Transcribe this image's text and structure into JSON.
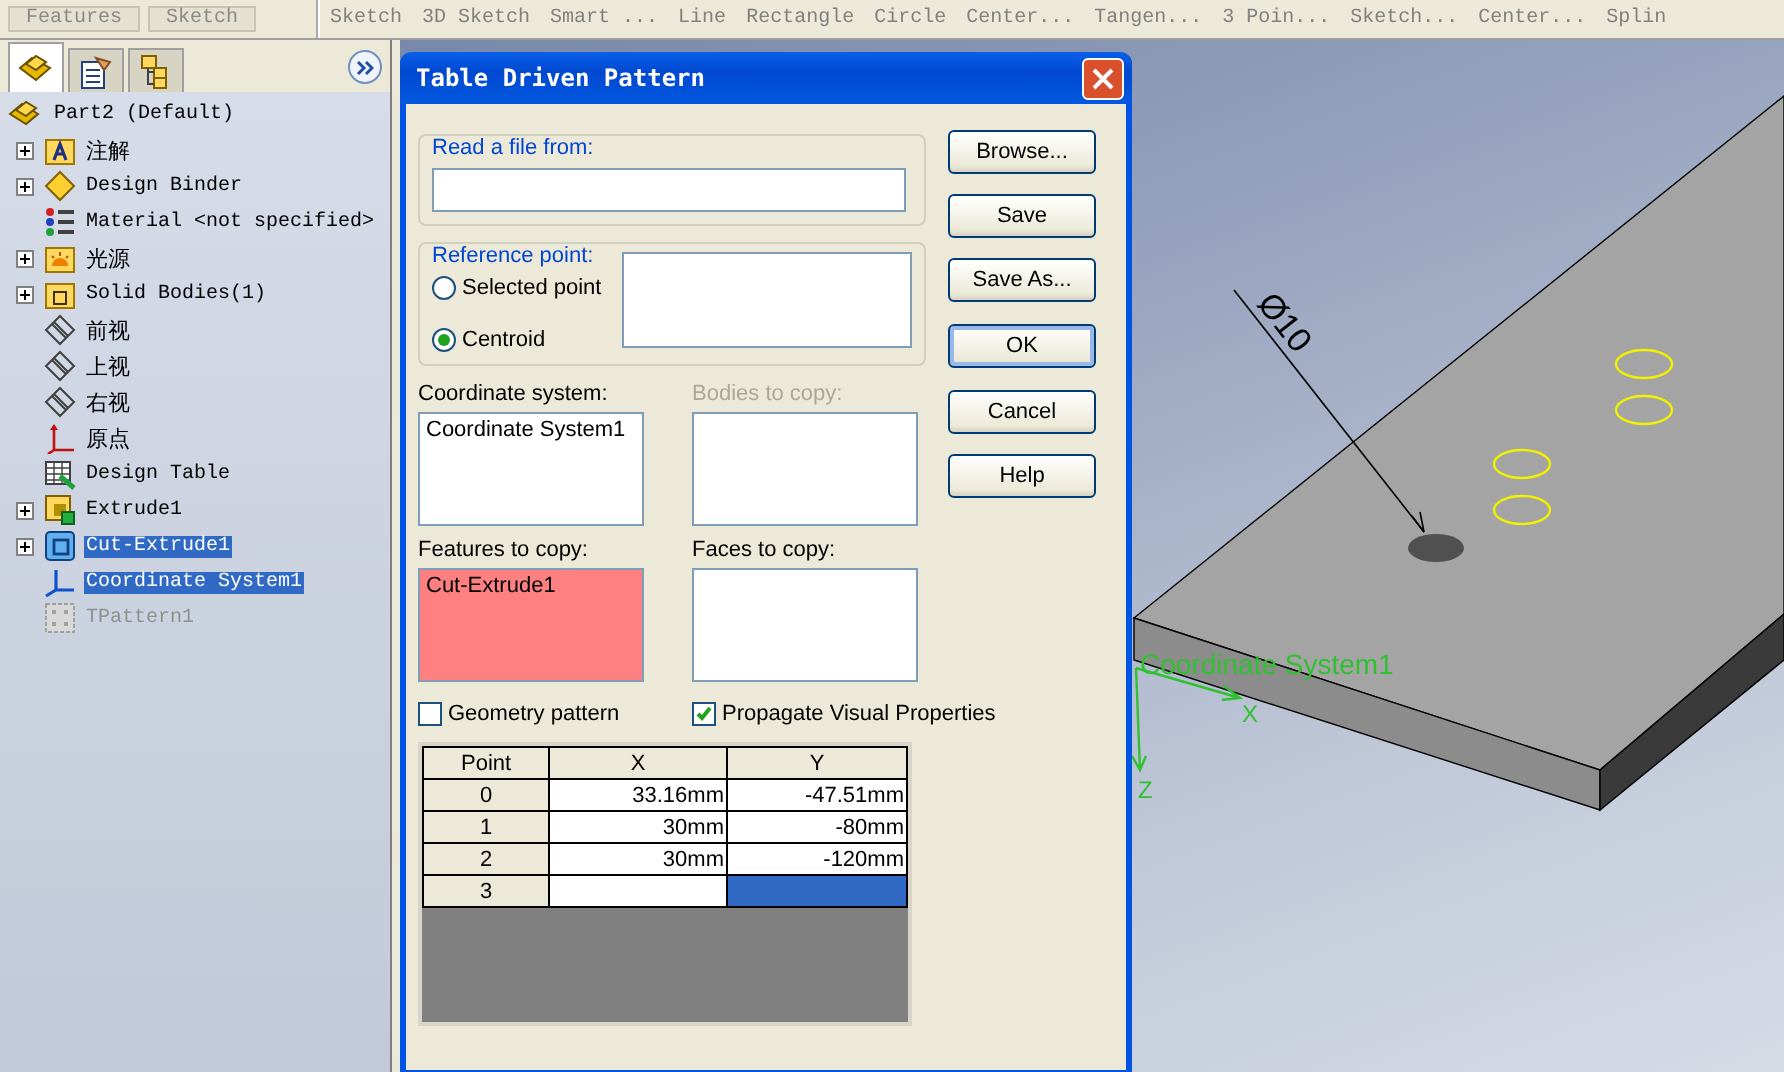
{
  "command_bar": {
    "tabs": [
      {
        "label": "Features",
        "selected": false
      },
      {
        "label": "Sketch",
        "selected": false
      }
    ],
    "commands": [
      "Sketch",
      "3D Sketch",
      "Smart ...",
      "Line",
      "Rectangle",
      "Circle",
      "Center...",
      "Tangen...",
      "3 Poin...",
      "Sketch...",
      "Center...",
      "Splin"
    ]
  },
  "panel_tabs": [
    {
      "kind": "feature-manager",
      "selected": true
    },
    {
      "kind": "property-manager",
      "selected": false
    },
    {
      "kind": "configuration-manager",
      "selected": false
    }
  ],
  "tree": {
    "label": "Part2  (Default)",
    "kind": "part",
    "children": [
      {
        "label": "注解",
        "kind": "annotations",
        "expandable": true,
        "selected": false,
        "disabled": false
      },
      {
        "label": "Design Binder",
        "kind": "binder",
        "expandable": true,
        "selected": false,
        "disabled": false
      },
      {
        "label": "Material <not specified>",
        "kind": "material",
        "expandable": false,
        "selected": false,
        "disabled": false
      },
      {
        "label": "光源",
        "kind": "lights",
        "expandable": true,
        "selected": false,
        "disabled": false
      },
      {
        "label": "Solid Bodies(1)",
        "kind": "bodies",
        "expandable": true,
        "selected": false,
        "disabled": false
      },
      {
        "label": "前视",
        "kind": "plane",
        "expandable": false,
        "selected": false,
        "disabled": false
      },
      {
        "label": "上视",
        "kind": "plane",
        "expandable": false,
        "selected": false,
        "disabled": false
      },
      {
        "label": "右视",
        "kind": "plane",
        "expandable": false,
        "selected": false,
        "disabled": false
      },
      {
        "label": "原点",
        "kind": "origin",
        "expandable": false,
        "selected": false,
        "disabled": false
      },
      {
        "label": "Design Table",
        "kind": "table",
        "expandable": false,
        "selected": false,
        "disabled": false
      },
      {
        "label": "Extrude1",
        "kind": "extrude",
        "expandable": true,
        "selected": false,
        "disabled": false
      },
      {
        "label": "Cut-Extrude1",
        "kind": "cut",
        "expandable": true,
        "selected": true,
        "disabled": false
      },
      {
        "label": "Coordinate System1",
        "kind": "coordsys",
        "expandable": false,
        "selected": true,
        "disabled": false
      },
      {
        "label": "TPattern1",
        "kind": "pattern",
        "expandable": false,
        "selected": false,
        "disabled": true
      }
    ]
  },
  "dialog": {
    "title": "Table Driven Pattern",
    "read_file": {
      "label": "Read a file from:"
    },
    "reference_point": {
      "label": "Reference point:",
      "options": [
        {
          "label": "Selected point",
          "selected": false
        },
        {
          "label": "Centroid",
          "selected": true
        }
      ]
    },
    "lists": [
      {
        "label": "Coordinate system:",
        "disabled": false,
        "highlighted": false,
        "items": [
          "Coordinate System1"
        ]
      },
      {
        "label": "Bodies to copy:",
        "disabled": true,
        "highlighted": false
      },
      {
        "label": "Features to copy:",
        "disabled": false,
        "highlighted": true,
        "items": [
          "Cut-Extrude1"
        ]
      },
      {
        "label": "Faces to copy:",
        "disabled": false,
        "highlighted": false
      }
    ],
    "checkboxes": [
      {
        "label": "Geometry pattern",
        "checked": false
      },
      {
        "label": "Propagate Visual Properties",
        "checked": true
      }
    ],
    "table": {
      "columns": [
        "Point",
        "X",
        "Y"
      ],
      "rows": [
        {
          "cells": [
            {
              "text": "0",
              "selected": false
            },
            {
              "text": "33.16mm",
              "selected": false
            },
            {
              "text": "-47.51mm",
              "selected": false
            }
          ]
        },
        {
          "cells": [
            {
              "text": "1",
              "selected": false
            },
            {
              "text": "30mm",
              "selected": false
            },
            {
              "text": "-80mm",
              "selected": false
            }
          ]
        },
        {
          "cells": [
            {
              "text": "2",
              "selected": false
            },
            {
              "text": "30mm",
              "selected": false
            },
            {
              "text": "-120mm",
              "selected": false
            }
          ]
        },
        {
          "cells": [
            {
              "text": "3",
              "selected": false
            },
            {
              "selected": false
            },
            {
              "selected": true
            }
          ]
        }
      ]
    },
    "buttons": [
      {
        "label": "Browse...",
        "default": false
      },
      {
        "label": "Save",
        "default": false
      },
      {
        "label": "Save As...",
        "default": false
      },
      {
        "label": "OK",
        "default": true
      },
      {
        "label": "Cancel",
        "default": false
      },
      {
        "label": "Help",
        "default": false
      }
    ]
  },
  "viewport": {
    "dimension": "Ø10",
    "coordinate_system": "Coordinate System1",
    "axes": [
      "X",
      "Z"
    ]
  }
}
